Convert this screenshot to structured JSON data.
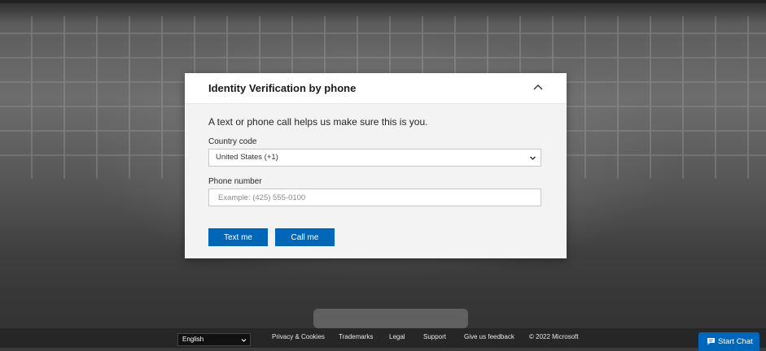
{
  "modal": {
    "title": "Identity Verification by phone",
    "subtitle": "A text or phone call helps us make sure this is you.",
    "country_label": "Country code",
    "country_value": "United States (+1)",
    "phone_label": "Phone number",
    "phone_placeholder": "Example: (425) 555-0100",
    "phone_value": "",
    "text_button": "Text me",
    "call_button": "Call me"
  },
  "footer": {
    "language": "English",
    "links": [
      "Privacy & Cookies",
      "Trademarks",
      "Legal",
      "Support",
      "Give us feedback"
    ],
    "copyright": "© 2022 Microsoft",
    "chat_button": "Start Chat"
  },
  "colors": {
    "accent": "#0067b8",
    "footer_bg": "#262626",
    "modal_bg": "#f3f3f4"
  },
  "icons": [
    "chevron-up-icon",
    "chevron-down-icon",
    "chat-icon"
  ]
}
